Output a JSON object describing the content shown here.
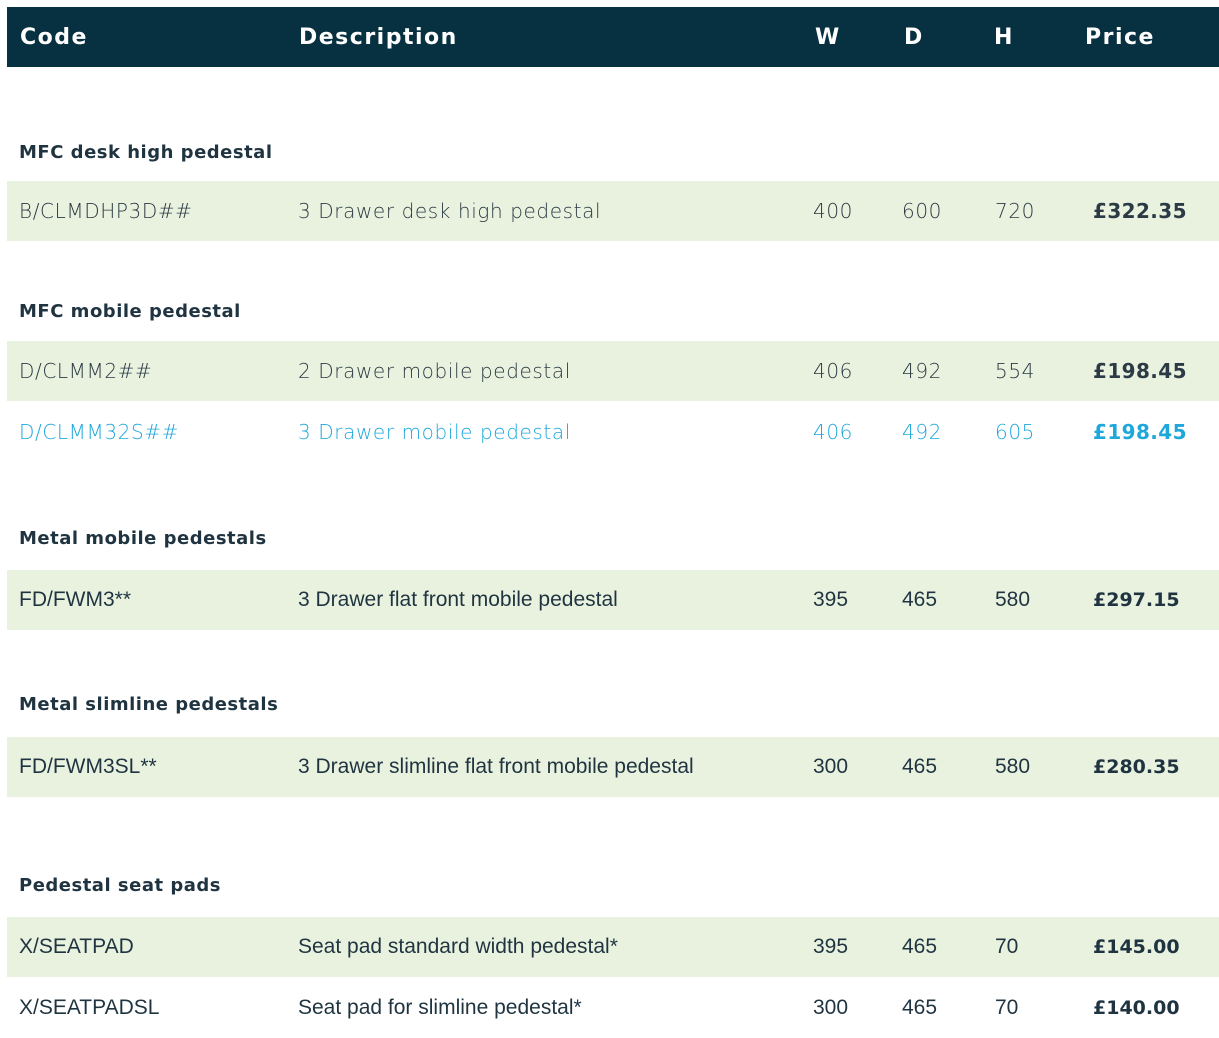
{
  "header": {
    "code": "Code",
    "description": "Description",
    "w": "W",
    "d": "D",
    "h": "H",
    "price": "Price"
  },
  "colors": {
    "header_bg": "#073041",
    "row_shade": "#e9f2df",
    "highlight": "#1ea7db",
    "text": "#1f3440"
  },
  "sections": [
    {
      "title": "MFC desk high pedestal",
      "rows": [
        {
          "code": "B/CLMDHP3D##",
          "description": "3 Drawer desk high pedestal",
          "w": "400",
          "d": "600",
          "h": "720",
          "price": "£322.35"
        }
      ]
    },
    {
      "title": "MFC mobile pedestal",
      "rows": [
        {
          "code": "D/CLMM2##",
          "description": "2 Drawer mobile pedestal",
          "w": "406",
          "d": "492",
          "h": "554",
          "price": "£198.45"
        },
        {
          "code": "D/CLMM32S##",
          "description": "3 Drawer mobile pedestal",
          "w": "406",
          "d": "492",
          "h": "605",
          "price": "£198.45"
        }
      ]
    },
    {
      "title": "Metal mobile pedestals",
      "rows": [
        {
          "code": "FD/FWM3**",
          "description": "3 Drawer flat front mobile pedestal",
          "w": "395",
          "d": "465",
          "h": "580",
          "price": "£297.15"
        }
      ]
    },
    {
      "title": "Metal slimline pedestals",
      "rows": [
        {
          "code": "FD/FWM3SL**",
          "description": "3 Drawer slimline flat front mobile pedestal",
          "w": "300",
          "d": "465",
          "h": "580",
          "price": "£280.35"
        }
      ]
    },
    {
      "title": "Pedestal seat pads",
      "rows": [
        {
          "code": "X/SEATPAD",
          "description": "Seat pad standard width pedestal*",
          "w": "395",
          "d": "465",
          "h": "70",
          "price": "£145.00"
        },
        {
          "code": "X/SEATPADSL",
          "description": "Seat pad for slimline pedestal*",
          "w": "300",
          "d": "465",
          "h": "70",
          "price": "£140.00"
        }
      ]
    }
  ]
}
